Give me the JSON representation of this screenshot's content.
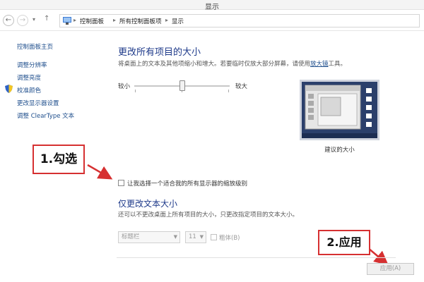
{
  "window": {
    "title": "显示"
  },
  "nav": {
    "back_glyph": "←",
    "forward_glyph": "→",
    "recent_glyph": "▾",
    "up_glyph": "↑",
    "breadcrumbs": [
      "控制面板",
      "所有控制面板项",
      "显示"
    ],
    "separator": "▸"
  },
  "sidebar": {
    "items": [
      {
        "label": "控制面板主页",
        "icon": ""
      },
      {
        "label": "调整分辨率",
        "icon": ""
      },
      {
        "label": "调整亮度",
        "icon": ""
      },
      {
        "label": "校准颜色",
        "icon": "shield-icon"
      },
      {
        "label": "更改显示器设置",
        "icon": ""
      },
      {
        "label": "调整 ClearType 文本",
        "icon": ""
      }
    ]
  },
  "main": {
    "size_heading": "更改所有项目的大小",
    "size_desc_prefix": "将桌面上的文本及其他项缩小和增大。若要临时仅放大部分屏幕，请使用",
    "size_desc_link": "放大镜",
    "size_desc_suffix": "工具。",
    "slider": {
      "min_label": "较小",
      "max_label": "较大",
      "level": 0.5
    },
    "preview_caption": "建议的大小",
    "scale_checkbox_label": "让我选择一个适合我的所有显示器的缩放级别",
    "scale_checkbox_checked": false,
    "text_heading": "仅更改文本大小",
    "text_desc": "还可以不更改桌面上所有项目的大小，只更改指定项目的文本大小。",
    "text_item_select": "标题栏",
    "font_size_select": "11",
    "bold_label": "粗体(B)",
    "apply_label": "应用(A)"
  },
  "annotations": {
    "step1": "1.勾选",
    "step2": "2.应用",
    "color": "#d63031"
  }
}
